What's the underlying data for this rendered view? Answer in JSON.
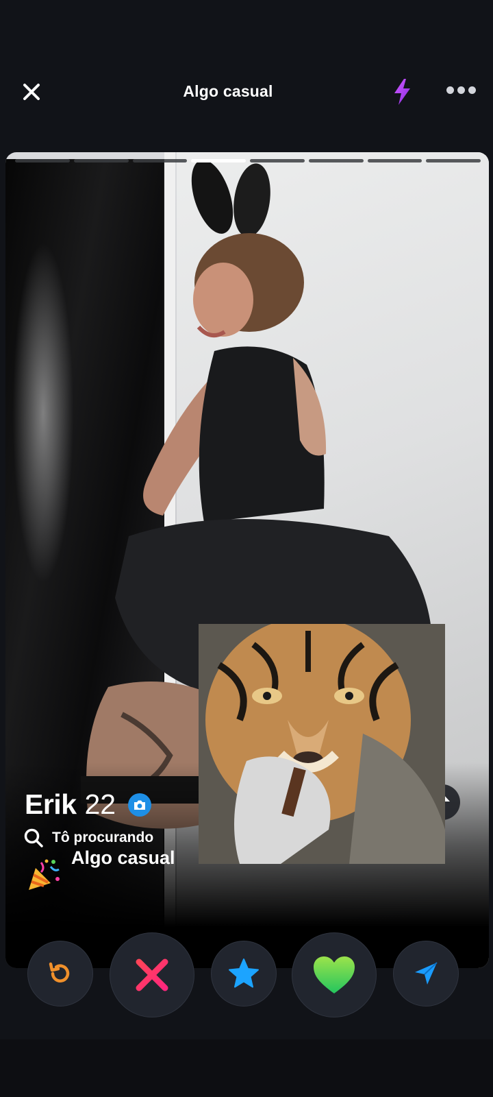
{
  "header": {
    "title": "Algo casual",
    "close_icon": "close-icon",
    "boost_icon": "lightning-icon",
    "more_icon": "more-dots-icon"
  },
  "photo_progress": {
    "total": 8,
    "current": 4
  },
  "profile": {
    "name": "Erik",
    "age": "22",
    "verified_icon": "camera-icon",
    "looking_for_label": "Tô procurando",
    "looking_for_value": "Algo casual",
    "looking_for_emoji": "party-popper-icon"
  },
  "actions": [
    {
      "name": "rewind",
      "icon": "rewind-icon",
      "color": "#f0902b"
    },
    {
      "name": "nope",
      "icon": "x-icon",
      "color": "#fd267d"
    },
    {
      "name": "super-like",
      "icon": "star-icon",
      "color": "#1ca4ff"
    },
    {
      "name": "like",
      "icon": "heart-icon",
      "color": "#5cd65c"
    },
    {
      "name": "boost",
      "icon": "send-icon",
      "color": "#1a9cff"
    }
  ],
  "colors": {
    "background": "#111318",
    "boost_purple": "#b548f5",
    "verified_blue": "#1e8fe6"
  }
}
